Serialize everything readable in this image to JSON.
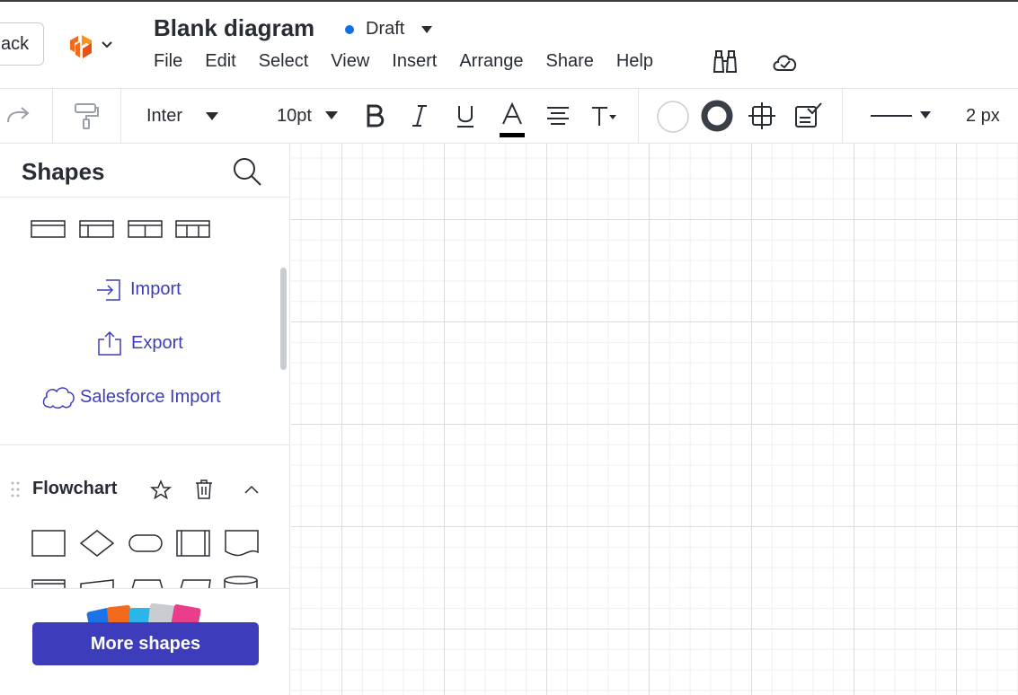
{
  "header": {
    "back_label": "ack",
    "title": "Blank diagram",
    "status": "Draft",
    "status_color": "#1071e5",
    "logo_color": "#f26a1b",
    "menu": [
      "File",
      "Edit",
      "Select",
      "View",
      "Insert",
      "Arrange",
      "Share",
      "Help"
    ],
    "icons": [
      "binoculars-icon",
      "cloud-check-icon"
    ]
  },
  "toolbar": {
    "font_family": "Inter",
    "font_size": "10pt",
    "line_width": "2 px",
    "icons": [
      "redo-icon",
      "format-painter-icon",
      "bold-icon",
      "italic-icon",
      "underline-icon",
      "text-color-icon",
      "align-icon",
      "text-options-icon",
      "fill-color-icon",
      "line-color-icon",
      "crop-icon",
      "conditional-format-icon",
      "line-style-icon"
    ]
  },
  "shapes_panel": {
    "title": "Shapes",
    "links": [
      {
        "label": "Import",
        "icon": "import-icon"
      },
      {
        "label": "Export",
        "icon": "export-icon"
      },
      {
        "label": "Salesforce Import",
        "icon": "salesforce-cloud-icon"
      }
    ],
    "section": {
      "title": "Flowchart",
      "shapes": [
        "process",
        "decision",
        "terminator",
        "predefined-process",
        "document"
      ]
    },
    "more_shapes_label": "More shapes",
    "accent_color": "#3d3dbb"
  }
}
